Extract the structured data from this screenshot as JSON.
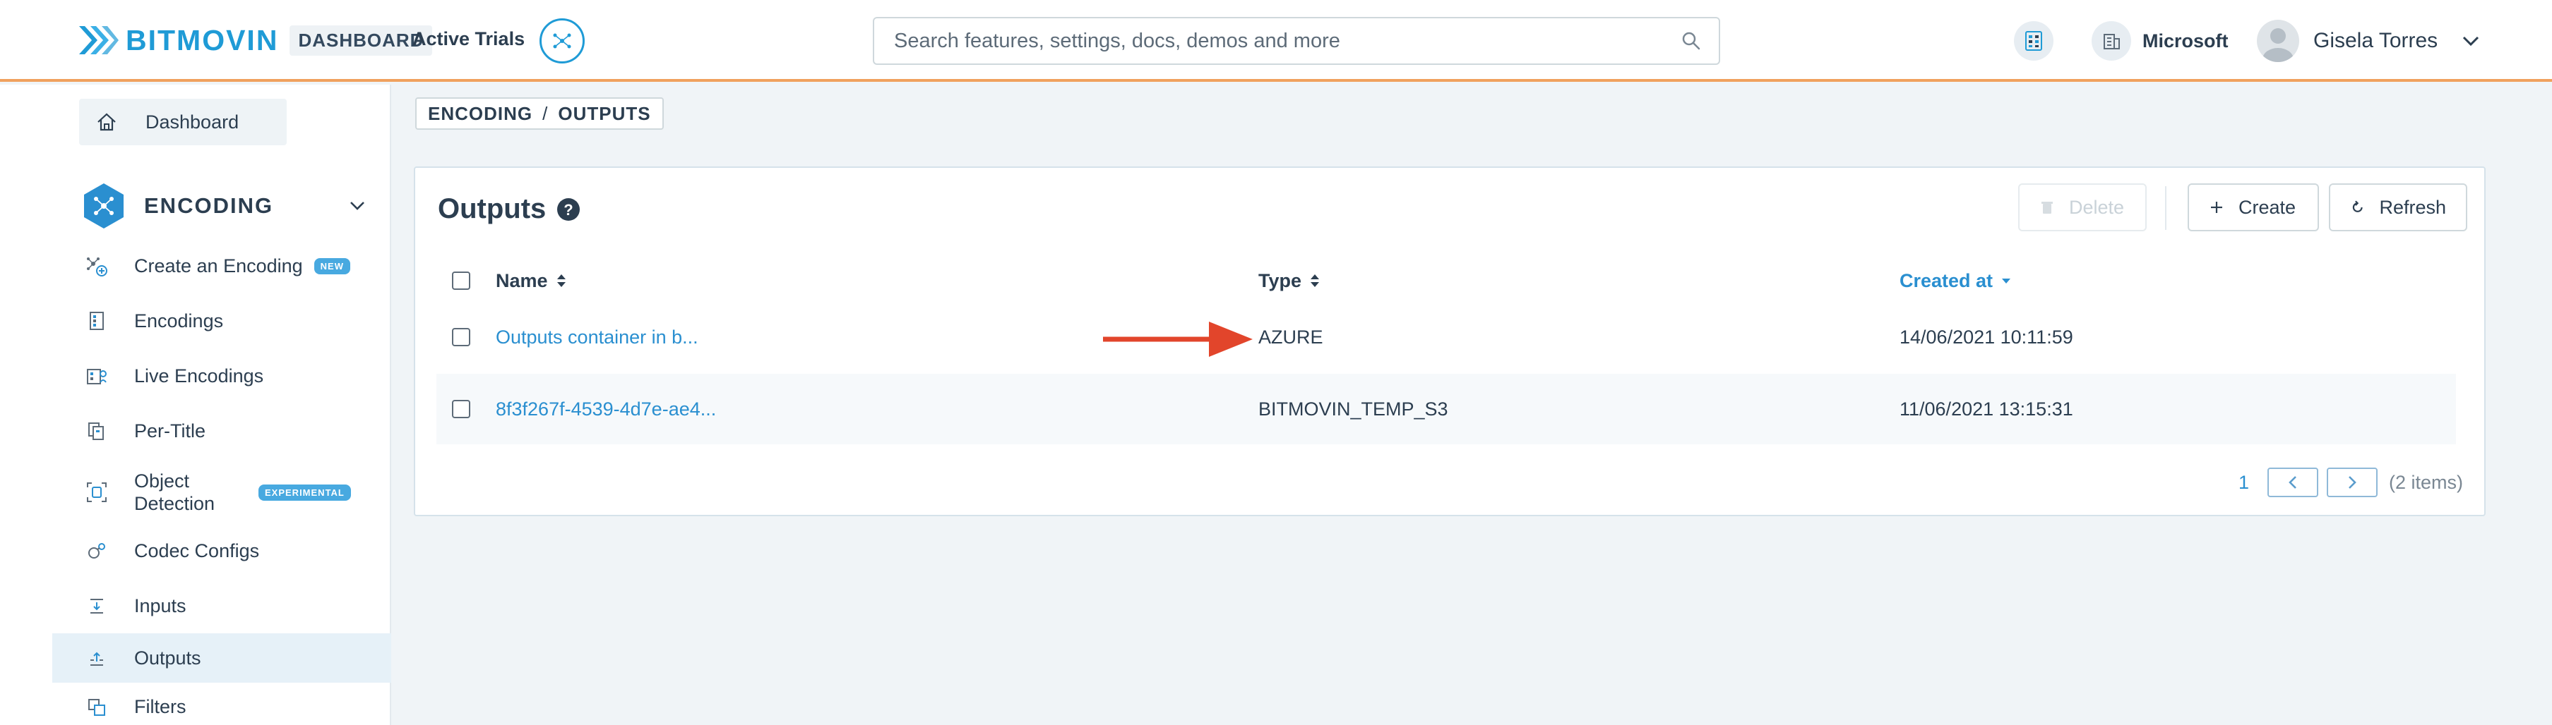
{
  "header": {
    "logo_text": "BITMOVIN",
    "logo_sub": "DASHBOARD",
    "active_trials": "Active Trials",
    "search_placeholder": "Search features, settings, docs, demos and more",
    "org_name": "Microsoft",
    "user_name": "Gisela Torres"
  },
  "sidebar": {
    "dashboard": "Dashboard",
    "section": "ENCODING",
    "items": [
      {
        "label": "Create an Encoding",
        "badge": "NEW",
        "icon": "create-encoding-icon"
      },
      {
        "label": "Encodings",
        "icon": "encodings-icon"
      },
      {
        "label": "Live Encodings",
        "icon": "live-encodings-icon"
      },
      {
        "label": "Per-Title",
        "icon": "per-title-icon"
      },
      {
        "label": "Object Detection",
        "badge": "EXPERIMENTAL",
        "icon": "object-detection-icon"
      },
      {
        "label": "Codec Configs",
        "icon": "codec-configs-icon"
      },
      {
        "label": "Inputs",
        "icon": "inputs-icon"
      },
      {
        "label": "Outputs",
        "icon": "outputs-icon",
        "active": true
      },
      {
        "label": "Filters",
        "icon": "filters-icon"
      }
    ]
  },
  "breadcrumb": {
    "first": "ENCODING",
    "separator": "/",
    "second": "OUTPUTS"
  },
  "card": {
    "title": "Outputs",
    "buttons": {
      "delete": "Delete",
      "create": "Create",
      "refresh": "Refresh"
    },
    "columns": {
      "name": "Name",
      "type": "Type",
      "created_at": "Created at"
    },
    "rows": [
      {
        "name": "Outputs container in b...",
        "type": "AZURE",
        "created": "14/06/2021 10:11:59"
      },
      {
        "name": "8f3f267f-4539-4d7e-ae4...",
        "type": "BITMOVIN_TEMP_S3",
        "created": "11/06/2021 13:15:31"
      }
    ],
    "pager": {
      "page": "1",
      "count": "(2 items)"
    }
  },
  "colors": {
    "accent": "#1f9bd6",
    "link": "#2a8fd0",
    "header_border": "#f0a15e",
    "arrow": "#e2452b"
  }
}
